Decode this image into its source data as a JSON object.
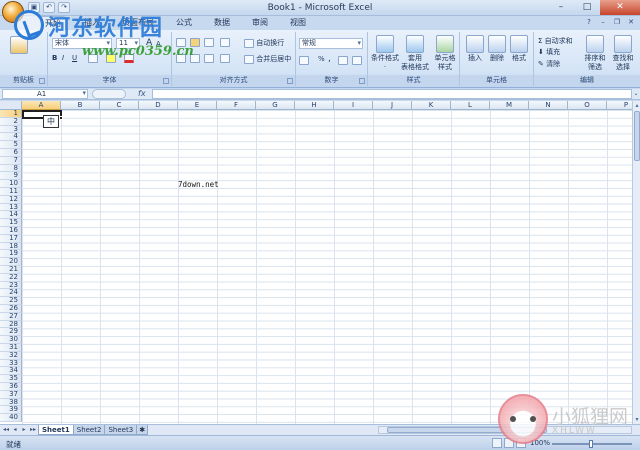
{
  "window": {
    "title": "Book1 - Microsoft Excel",
    "controls": [
      "–",
      "□",
      "✕"
    ]
  },
  "ribbon": {
    "tabs": [
      "开始",
      "插入",
      "页面布局",
      "公式",
      "数据",
      "审阅",
      "视图"
    ],
    "active_tab": "开始",
    "clipboard": {
      "label": "剪贴板"
    },
    "font": {
      "label": "字体",
      "font_name": "宋体",
      "font_size": "11",
      "grow_label": "A",
      "shrink_label": "A",
      "bold": "B",
      "italic": "I",
      "underline": "U"
    },
    "alignment": {
      "label": "对齐方式",
      "wrap_text": "自动换行",
      "merge_center": "合并后居中"
    },
    "number": {
      "label": "数字",
      "format": "常规",
      "percent": "%",
      "comma": ","
    },
    "styles": {
      "label": "样式",
      "conditional": [
        "条件格式",
        "·"
      ],
      "table": [
        "套用",
        "表格格式"
      ],
      "cell": [
        "单元格",
        "样式"
      ]
    },
    "cells": {
      "label": "单元格",
      "insert": "插入",
      "delete": "删除",
      "format": "格式"
    },
    "editing": {
      "label": "编辑",
      "autosum": "自动求和",
      "fill": "填充",
      "clear": "清除",
      "sort_filter": [
        "排序和",
        "筛选"
      ],
      "find_select": [
        "查找和",
        "选择"
      ]
    }
  },
  "watermark": {
    "site_name": "河东软件园",
    "site_url": "www.pc0359.cn",
    "fox_name": "小狐狸网",
    "fox_sub": "XHLWW"
  },
  "formula_bar": {
    "name_box": "A1",
    "fx": "fx",
    "formula": ""
  },
  "grid": {
    "columns": [
      "A",
      "B",
      "C",
      "D",
      "E",
      "F",
      "G",
      "H",
      "I",
      "J",
      "K",
      "L",
      "M",
      "N",
      "O",
      "P"
    ],
    "rows": [
      "1",
      "2",
      "3",
      "4",
      "5",
      "6",
      "7",
      "8",
      "9",
      "10",
      "11",
      "12",
      "13",
      "14",
      "15",
      "16",
      "17",
      "18",
      "19",
      "20",
      "21",
      "22",
      "23",
      "24",
      "25",
      "26",
      "27",
      "28",
      "29",
      "30",
      "31",
      "32",
      "33",
      "34",
      "35",
      "36",
      "37",
      "38",
      "39",
      "40"
    ],
    "selected_column": "A",
    "selected_row": "1",
    "cell_e8": "7down.net",
    "ime_char": "中"
  },
  "sheets": {
    "tabs": [
      "Sheet1",
      "Sheet2",
      "Sheet3"
    ],
    "active": "Sheet1",
    "nav": [
      "◂◂",
      "◂",
      "▸",
      "▸▸"
    ]
  },
  "status": {
    "mode": "就绪",
    "zoom": "100%"
  }
}
